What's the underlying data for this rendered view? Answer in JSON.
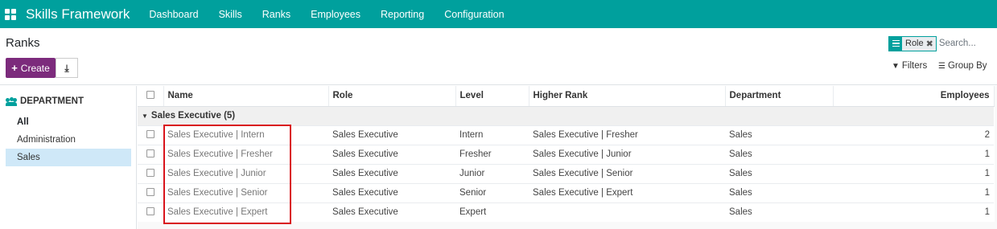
{
  "navbar": {
    "app_title": "Skills Framework",
    "items": [
      "Dashboard",
      "Skills",
      "Ranks",
      "Employees",
      "Reporting",
      "Configuration"
    ]
  },
  "control": {
    "title": "Ranks",
    "create_label": "Create",
    "facet_label": "Role",
    "facet_remove": "✖",
    "search_placeholder": "Search...",
    "filters_label": "Filters",
    "groupby_label": "Group By"
  },
  "sidebar": {
    "heading": "DEPARTMENT",
    "items": [
      "All",
      "Administration",
      "Sales"
    ],
    "selected": "Sales"
  },
  "table": {
    "columns": [
      "Name",
      "Role",
      "Level",
      "Higher Rank",
      "Department",
      "Employees"
    ],
    "group": {
      "label": "Sales Executive (5)"
    },
    "rows": [
      {
        "name": "Sales Executive | Intern",
        "role": "Sales Executive",
        "level": "Intern",
        "higher": "Sales Executive | Fresher",
        "dept": "Sales",
        "employees": "2"
      },
      {
        "name": "Sales Executive | Fresher",
        "role": "Sales Executive",
        "level": "Fresher",
        "higher": "Sales Executive | Junior",
        "dept": "Sales",
        "employees": "1"
      },
      {
        "name": "Sales Executive | Junior",
        "role": "Sales Executive",
        "level": "Junior",
        "higher": "Sales Executive | Senior",
        "dept": "Sales",
        "employees": "1"
      },
      {
        "name": "Sales Executive | Senior",
        "role": "Sales Executive",
        "level": "Senior",
        "higher": "Sales Executive | Expert",
        "dept": "Sales",
        "employees": "1"
      },
      {
        "name": "Sales Executive | Expert",
        "role": "Sales Executive",
        "level": "Expert",
        "higher": "",
        "dept": "Sales",
        "employees": "1"
      }
    ]
  },
  "colors": {
    "brand": "#00A09D",
    "create_button": "#7C2B7C",
    "highlight": "#d9141c",
    "selected_bg": "#cfe8f8"
  },
  "icons": {
    "apps": "apps-grid-icon",
    "download": "download-icon",
    "filter": "filter-icon",
    "groupby": "list-icon",
    "department": "users-icon",
    "facet": "group-by-facet-icon"
  }
}
